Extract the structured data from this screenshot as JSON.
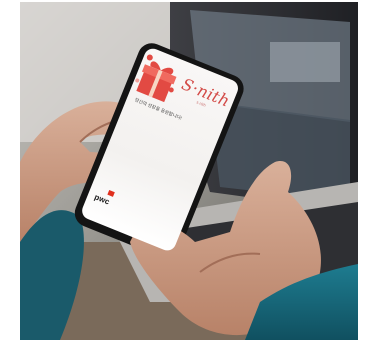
{
  "app": {
    "logo_text": "S·nith",
    "logo_sub": "s·nith",
    "tagline": "당신의 성장을 응원합니다!",
    "brand": "pwc"
  },
  "scene": {
    "subject": "hands-holding-smartphone",
    "background": "laptop-on-desk"
  }
}
